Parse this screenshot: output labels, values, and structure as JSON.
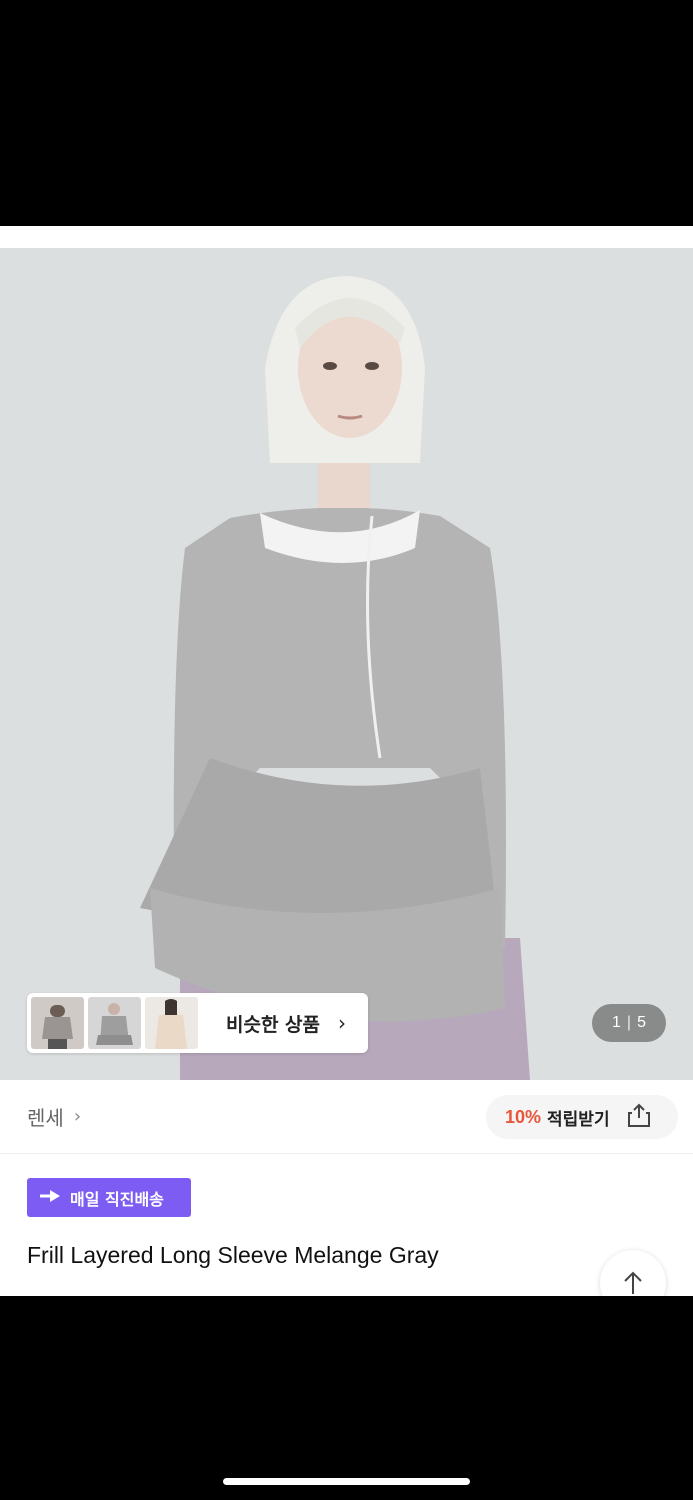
{
  "similar": {
    "label": "비슷한 상품",
    "chevron": "›",
    "thumbnails": [
      "thumb-gray-frill",
      "thumb-gray-top",
      "thumb-beige-top"
    ]
  },
  "gallery": {
    "current": "1",
    "separator": "|",
    "total": "5"
  },
  "brand": {
    "name": "렌세",
    "chevron": "›"
  },
  "reward": {
    "percent": "10%",
    "label": "적립받기",
    "icon": "share-icon"
  },
  "delivery": {
    "label": "매일 직진배송",
    "icon": "arrow-badge-icon"
  },
  "product": {
    "title": "Frill Layered Long Sleeve Melange Gray"
  },
  "colors": {
    "accent_purple": "#7c5cf2",
    "reward_orange": "#e8573a"
  }
}
